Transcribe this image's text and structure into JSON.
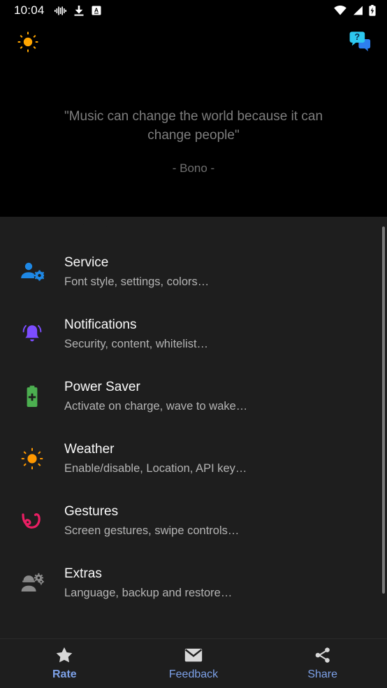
{
  "statusbar": {
    "time": "10:04",
    "left_icons": [
      "audio-wave-icon",
      "download-icon",
      "letter-a-badge-icon"
    ],
    "right_icons": [
      "wifi-icon",
      "cellular-signal-icon",
      "battery-charging-icon"
    ]
  },
  "topbar": {
    "left_icon_name": "sun-icon",
    "right_icon_name": "help-chat-bubble-icon",
    "colors": {
      "sun": "#FFA500",
      "help_front": "#2DC8F0",
      "help_back": "#2D7FF0"
    }
  },
  "quote": {
    "text": "\"Music can change the world because it can change people\"",
    "author": "- Bono -"
  },
  "settings": {
    "items": [
      {
        "title": "Service",
        "subtitle": "Font style, settings, colors…",
        "icon": "person-gear-icon",
        "color": "#1E88E5"
      },
      {
        "title": "Notifications",
        "subtitle": "Security, content, whitelist…",
        "icon": "bell-ringing-icon",
        "color": "#7C4DFF"
      },
      {
        "title": "Power Saver",
        "subtitle": "Activate on charge, wave to wake…",
        "icon": "battery-plus-icon",
        "color": "#4CAF50"
      },
      {
        "title": "Weather",
        "subtitle": "Enable/disable, Location, API key…",
        "icon": "sun-icon",
        "color": "#FF9800"
      },
      {
        "title": "Gestures",
        "subtitle": "Screen gestures, swipe controls…",
        "icon": "gesture-swirl-icon",
        "color": "#E91E63"
      },
      {
        "title": "Extras",
        "subtitle": "Language, backup and restore…",
        "icon": "engineer-gear-icon",
        "color": "#8A8A8A"
      }
    ]
  },
  "bottombar": {
    "items": [
      {
        "label": "Rate",
        "icon": "star-icon",
        "active": true
      },
      {
        "label": "Feedback",
        "icon": "envelope-icon",
        "active": false
      },
      {
        "label": "Share",
        "icon": "share-icon",
        "active": false
      }
    ],
    "label_color": "#7da1e8"
  }
}
